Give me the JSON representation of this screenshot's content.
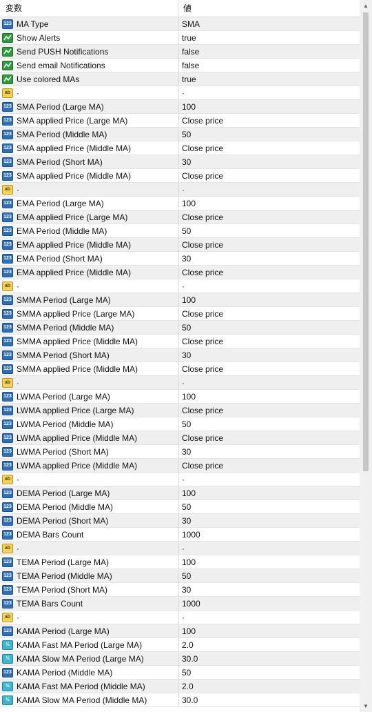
{
  "header": {
    "variable": "変数",
    "value": "値"
  },
  "rows": [
    {
      "type": "int",
      "icon": "int-icon",
      "name": "MA Type",
      "value": "SMA"
    },
    {
      "type": "bool",
      "icon": "bool-icon",
      "name": "Show Alerts",
      "value": "true"
    },
    {
      "type": "bool",
      "icon": "bool-icon",
      "name": "Send PUSH Notifications",
      "value": "false"
    },
    {
      "type": "bool",
      "icon": "bool-icon",
      "name": "Send email Notifications",
      "value": "false"
    },
    {
      "type": "bool",
      "icon": "bool-icon",
      "name": "Use colored MAs",
      "value": "true"
    },
    {
      "type": "str",
      "icon": "string-icon",
      "name": "·",
      "value": "·"
    },
    {
      "type": "int",
      "icon": "int-icon",
      "name": "SMA Period (Large MA)",
      "value": "100"
    },
    {
      "type": "int",
      "icon": "int-icon",
      "name": "SMA applied Price (Large MA)",
      "value": "Close price"
    },
    {
      "type": "int",
      "icon": "int-icon",
      "name": "SMA Period (Middle MA)",
      "value": "50"
    },
    {
      "type": "int",
      "icon": "int-icon",
      "name": "SMA applied Price (Middle MA)",
      "value": "Close price"
    },
    {
      "type": "int",
      "icon": "int-icon",
      "name": "SMA Period (Short MA)",
      "value": "30"
    },
    {
      "type": "int",
      "icon": "int-icon",
      "name": "SMA applied Price (Middle MA)",
      "value": "Close price"
    },
    {
      "type": "str",
      "icon": "string-icon",
      "name": "·",
      "value": "·"
    },
    {
      "type": "int",
      "icon": "int-icon",
      "name": "EMA Period (Large MA)",
      "value": "100"
    },
    {
      "type": "int",
      "icon": "int-icon",
      "name": "EMA applied Price (Large MA)",
      "value": "Close price"
    },
    {
      "type": "int",
      "icon": "int-icon",
      "name": "EMA Period (Middle MA)",
      "value": "50"
    },
    {
      "type": "int",
      "icon": "int-icon",
      "name": "EMA applied Price (Middle MA)",
      "value": "Close price"
    },
    {
      "type": "int",
      "icon": "int-icon",
      "name": "EMA Period (Short MA)",
      "value": "30"
    },
    {
      "type": "int",
      "icon": "int-icon",
      "name": "EMA applied Price (Middle MA)",
      "value": "Close price"
    },
    {
      "type": "str",
      "icon": "string-icon",
      "name": "·",
      "value": "·"
    },
    {
      "type": "int",
      "icon": "int-icon",
      "name": "SMMA Period (Large MA)",
      "value": "100"
    },
    {
      "type": "int",
      "icon": "int-icon",
      "name": "SMMA applied Price (Large MA)",
      "value": "Close price"
    },
    {
      "type": "int",
      "icon": "int-icon",
      "name": "SMMA Period (Middle MA)",
      "value": "50"
    },
    {
      "type": "int",
      "icon": "int-icon",
      "name": "SMMA applied Price (Middle MA)",
      "value": "Close price"
    },
    {
      "type": "int",
      "icon": "int-icon",
      "name": "SMMA Period (Short MA)",
      "value": "30"
    },
    {
      "type": "int",
      "icon": "int-icon",
      "name": "SMMA applied Price (Middle MA)",
      "value": "Close price"
    },
    {
      "type": "str",
      "icon": "string-icon",
      "name": "·",
      "value": "·"
    },
    {
      "type": "int",
      "icon": "int-icon",
      "name": "LWMA Period (Large MA)",
      "value": "100"
    },
    {
      "type": "int",
      "icon": "int-icon",
      "name": "LWMA applied Price (Large MA)",
      "value": "Close price"
    },
    {
      "type": "int",
      "icon": "int-icon",
      "name": "LWMA Period (Middle MA)",
      "value": "50"
    },
    {
      "type": "int",
      "icon": "int-icon",
      "name": "LWMA applied Price (Middle MA)",
      "value": "Close price"
    },
    {
      "type": "int",
      "icon": "int-icon",
      "name": "LWMA Period (Short MA)",
      "value": "30"
    },
    {
      "type": "int",
      "icon": "int-icon",
      "name": "LWMA applied Price (Middle MA)",
      "value": "Close price"
    },
    {
      "type": "str",
      "icon": "string-icon",
      "name": "·",
      "value": "·"
    },
    {
      "type": "int",
      "icon": "int-icon",
      "name": "DEMA Period (Large MA)",
      "value": "100"
    },
    {
      "type": "int",
      "icon": "int-icon",
      "name": "DEMA Period (Middle MA)",
      "value": "50"
    },
    {
      "type": "int",
      "icon": "int-icon",
      "name": "DEMA Period (Short MA)",
      "value": "30"
    },
    {
      "type": "int",
      "icon": "int-icon",
      "name": "DEMA Bars Count",
      "value": "1000"
    },
    {
      "type": "str",
      "icon": "string-icon",
      "name": "·",
      "value": "·"
    },
    {
      "type": "int",
      "icon": "int-icon",
      "name": "TEMA Period (Large MA)",
      "value": "100"
    },
    {
      "type": "int",
      "icon": "int-icon",
      "name": "TEMA Period (Middle MA)",
      "value": "50"
    },
    {
      "type": "int",
      "icon": "int-icon",
      "name": "TEMA Period (Short MA)",
      "value": "30"
    },
    {
      "type": "int",
      "icon": "int-icon",
      "name": "TEMA Bars Count",
      "value": "1000"
    },
    {
      "type": "str",
      "icon": "string-icon",
      "name": "·",
      "value": "·"
    },
    {
      "type": "int",
      "icon": "int-icon",
      "name": "KAMA Period (Large MA)",
      "value": "100"
    },
    {
      "type": "dbl",
      "icon": "double-icon",
      "name": "KAMA Fast MA Period (Large MA)",
      "value": "2.0"
    },
    {
      "type": "dbl",
      "icon": "double-icon",
      "name": "KAMA Slow MA Period (Large MA)",
      "value": "30.0"
    },
    {
      "type": "int",
      "icon": "int-icon",
      "name": "KAMA Period (Middle MA)",
      "value": "50"
    },
    {
      "type": "dbl",
      "icon": "double-icon",
      "name": "KAMA Fast MA Period (Middle MA)",
      "value": "2.0"
    },
    {
      "type": "dbl",
      "icon": "double-icon",
      "name": "KAMA Slow MA Period (Middle MA)",
      "value": "30.0"
    }
  ],
  "icon_labels": {
    "int": "123",
    "str": "ab",
    "dbl": "½"
  },
  "colors": {
    "int_icon": "#2f6fb6",
    "bool_icon": "#2e9b3c",
    "string_icon": "#f2d25a",
    "double_icon": "#3fb5cf",
    "row_alt": "#efefef"
  }
}
